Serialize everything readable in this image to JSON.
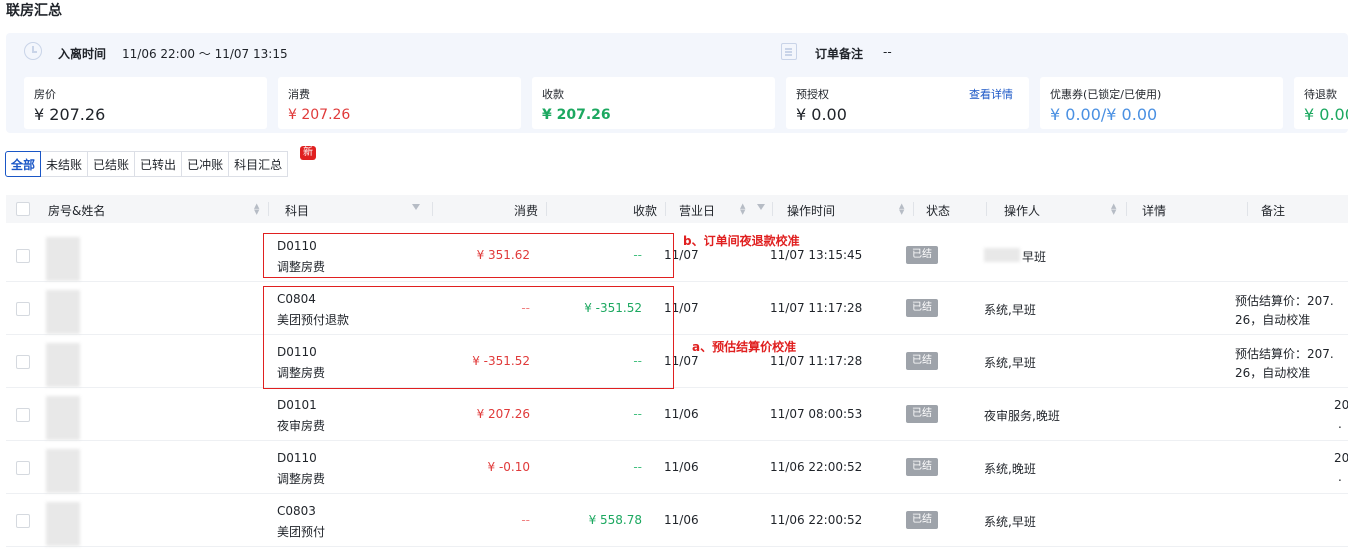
{
  "page_title": "联房汇总",
  "stay": {
    "label": "入离时间",
    "value": "11/06 22:00 ～ 11/07 13:15"
  },
  "order_note": {
    "label": "订单备注",
    "value": "--"
  },
  "cards": [
    {
      "label": "房价",
      "value": "¥ 207.26",
      "color": "#1f2329"
    },
    {
      "label": "消费",
      "value": "¥  207.26",
      "color": "#e03a3a"
    },
    {
      "label": "收款",
      "value": "¥   207.26",
      "color": "#1ca860"
    },
    {
      "label": "预授权",
      "value": "¥ 0.00",
      "link": "查看详情",
      "color": "#1f2329"
    },
    {
      "label": "优惠券(已锁定/已使用)",
      "value": "¥ 0.00/¥ 0.00",
      "color": "#4a90e2"
    },
    {
      "label": "待退款",
      "value": "¥ 0.00",
      "color": "#1ca860"
    }
  ],
  "tabs": [
    "全部",
    "未结账",
    "已结账",
    "已转出",
    "已冲账",
    "科目汇总"
  ],
  "new_badge": "新",
  "columns": {
    "room": "房号&姓名",
    "subject": "科目",
    "consume": "消费",
    "payment": "收款",
    "business_day": "营业日",
    "op_time": "操作时间",
    "status": "状态",
    "operator": "操作人",
    "detail": "详情",
    "remark": "备注"
  },
  "rows": [
    {
      "code": "D0110",
      "name": "调整房费",
      "consume": "¥ 351.62",
      "payment": "--",
      "day": "11/07",
      "time": "11/07 13:15:45",
      "status": "已结",
      "operator": "早班",
      "remark1": "",
      "remark2": ""
    },
    {
      "code": "C0804",
      "name": "美团预付退款",
      "consume": "--",
      "payment": "¥ -351.52",
      "day": "11/07",
      "time": "11/07 11:17:28",
      "status": "已结",
      "operator": "系统,早班",
      "remark1": "预估结算价：207.",
      "remark2": "26，自动校准"
    },
    {
      "code": "D0110",
      "name": "调整房费",
      "consume": "¥ -351.52",
      "payment": "--",
      "day": "11/07",
      "time": "11/07 11:17:28",
      "status": "已结",
      "operator": "系统,早班",
      "remark1": "预估结算价：207.",
      "remark2": "26，自动校准"
    },
    {
      "code": "D0101",
      "name": "夜审房费",
      "consume": "¥ 207.26",
      "payment": "--",
      "day": "11/06",
      "time": "11/07 08:00:53",
      "status": "已结",
      "operator": "夜审服务,晚班",
      "remark1": "20",
      "remark2": "."
    },
    {
      "code": "D0110",
      "name": "调整房费",
      "consume": "¥ -0.10",
      "payment": "--",
      "day": "11/06",
      "time": "11/06 22:00:52",
      "status": "已结",
      "operator": "系统,晚班",
      "remark1": "20",
      "remark2": "."
    },
    {
      "code": "C0803",
      "name": "美团预付",
      "consume": "--",
      "payment": "¥ 558.78",
      "day": "11/06",
      "time": "11/06 22:00:52",
      "status": "已结",
      "operator": "系统,早班",
      "remark1": "",
      "remark2": ""
    }
  ],
  "annotations": {
    "b": "b、订单间夜退款校准",
    "a": "a、预估结算价校准"
  }
}
